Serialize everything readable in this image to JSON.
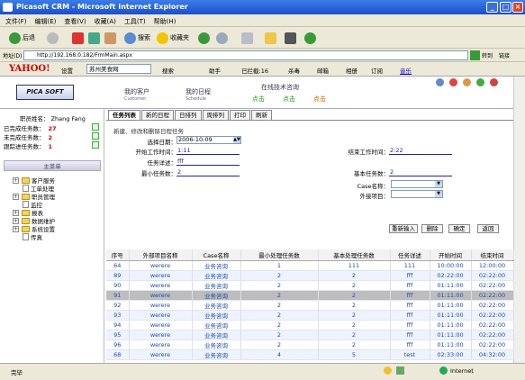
{
  "window": {
    "title": "Picasoft CRM - Microsoft Internet Explorer"
  },
  "menu": [
    "文件(F)",
    "编辑(E)",
    "查看(V)",
    "收藏(A)",
    "工具(T)",
    "帮助(H)"
  ],
  "toolbar": {
    "back": "后退",
    "search": "搜索",
    "favorites": "收藏夹"
  },
  "address": {
    "label": "地址(D)",
    "url": "http://192.168.0.182/FrmMain.aspx",
    "go": "转到",
    "links": "链接"
  },
  "yahoo": {
    "logo": "YAHOO!",
    "settings": "设置",
    "search_value": "苏州美食网",
    "search_btn": "搜索",
    "helper": "助手",
    "blocked": "已拦截:16",
    "antivirus": "杀毒",
    "mail": "邮箱",
    "album": "相册",
    "rss": "订阅",
    "music": "音乐"
  },
  "app": {
    "logo": "PICA SOFT",
    "nav_customer": "我的客户",
    "nav_customer_en": "Customer",
    "nav_schedule": "我的日程",
    "nav_schedule_en": "Schedule",
    "online_support": "在线技术咨询",
    "click": "点击"
  },
  "sidebar": {
    "name_label": "职员姓名：",
    "name": "Zhang Fang",
    "stats": [
      {
        "label": "已完成任务数：",
        "value": "27"
      },
      {
        "label": "未完成任务数：",
        "value": "2"
      },
      {
        "label": "跟踪进任务数：",
        "value": "1"
      }
    ],
    "menu_title": "主菜单",
    "tree": [
      {
        "label": "客户服务",
        "type": "folder",
        "expand": true
      },
      {
        "label": "工单处理",
        "type": "doc"
      },
      {
        "label": "职员管理",
        "type": "folder",
        "expand": true
      },
      {
        "label": "监控",
        "type": "doc"
      },
      {
        "label": "报表",
        "type": "folder",
        "expand": true
      },
      {
        "label": "数据维护",
        "type": "folder",
        "expand": true
      },
      {
        "label": "系统设置",
        "type": "folder",
        "expand": true
      },
      {
        "label": "传真",
        "type": "doc"
      }
    ]
  },
  "tabs": [
    "任务列表",
    "新的日程",
    "日排列",
    "周排列",
    "打印",
    "刷新"
  ],
  "form": {
    "title": "新建、修改和删除日程任务",
    "date_label": "选择日期：",
    "date": "2006-10-09",
    "start_label": "开始工作时间：",
    "start": "1:11",
    "end_label": "结束工作时间：",
    "end": "2:22",
    "detail_label": "任务详述：",
    "detail": "fff",
    "min_label": "最小任务数：",
    "min": "2",
    "base_label": "基本任务数：",
    "base": "2",
    "case_label": "Case名称：",
    "ext_label": "外接项目：",
    "buttons": [
      "重新输入",
      "删除",
      "确定",
      "返回"
    ]
  },
  "table": {
    "headers": [
      "序号",
      "外部项目名称",
      "Case名称",
      "最小处理任务数",
      "基本处理任务数",
      "任务详述",
      "开始时间",
      "结束时间"
    ],
    "rows": [
      [
        "64",
        "werere",
        "业务咨询",
        "1",
        "111",
        "111",
        "10:00:00",
        "12:00:00"
      ],
      [
        "89",
        "werere",
        "业务咨询",
        "2",
        "2",
        "fff",
        "02:22:00",
        "02:22:00"
      ],
      [
        "90",
        "werere",
        "业务咨询",
        "2",
        "2",
        "fff",
        "01:11:00",
        "02:22:00"
      ],
      [
        "91",
        "werere",
        "业务咨询",
        "2",
        "2",
        "fff",
        "01:11:00",
        "02:22:00"
      ],
      [
        "92",
        "werere",
        "业务咨询",
        "2",
        "2",
        "fff",
        "01:11:00",
        "02:22:00"
      ],
      [
        "93",
        "werere",
        "业务咨询",
        "2",
        "2",
        "fff",
        "01:11:00",
        "02:22:00"
      ],
      [
        "94",
        "werere",
        "业务咨询",
        "2",
        "2",
        "fff",
        "01:11:00",
        "02:22:00"
      ],
      [
        "95",
        "werere",
        "业务咨询",
        "2",
        "2",
        "fff",
        "01:11:00",
        "02:22:00"
      ],
      [
        "96",
        "werere",
        "业务咨询",
        "2",
        "2",
        "fff",
        "01:11:00",
        "02:22:00"
      ],
      [
        "68",
        "werere",
        "业务咨询",
        "4",
        "5",
        "test",
        "02:33:00",
        "04:32:00"
      ]
    ],
    "highlight_index": 3
  },
  "status": {
    "left": "完毕",
    "zone": "Internet"
  }
}
